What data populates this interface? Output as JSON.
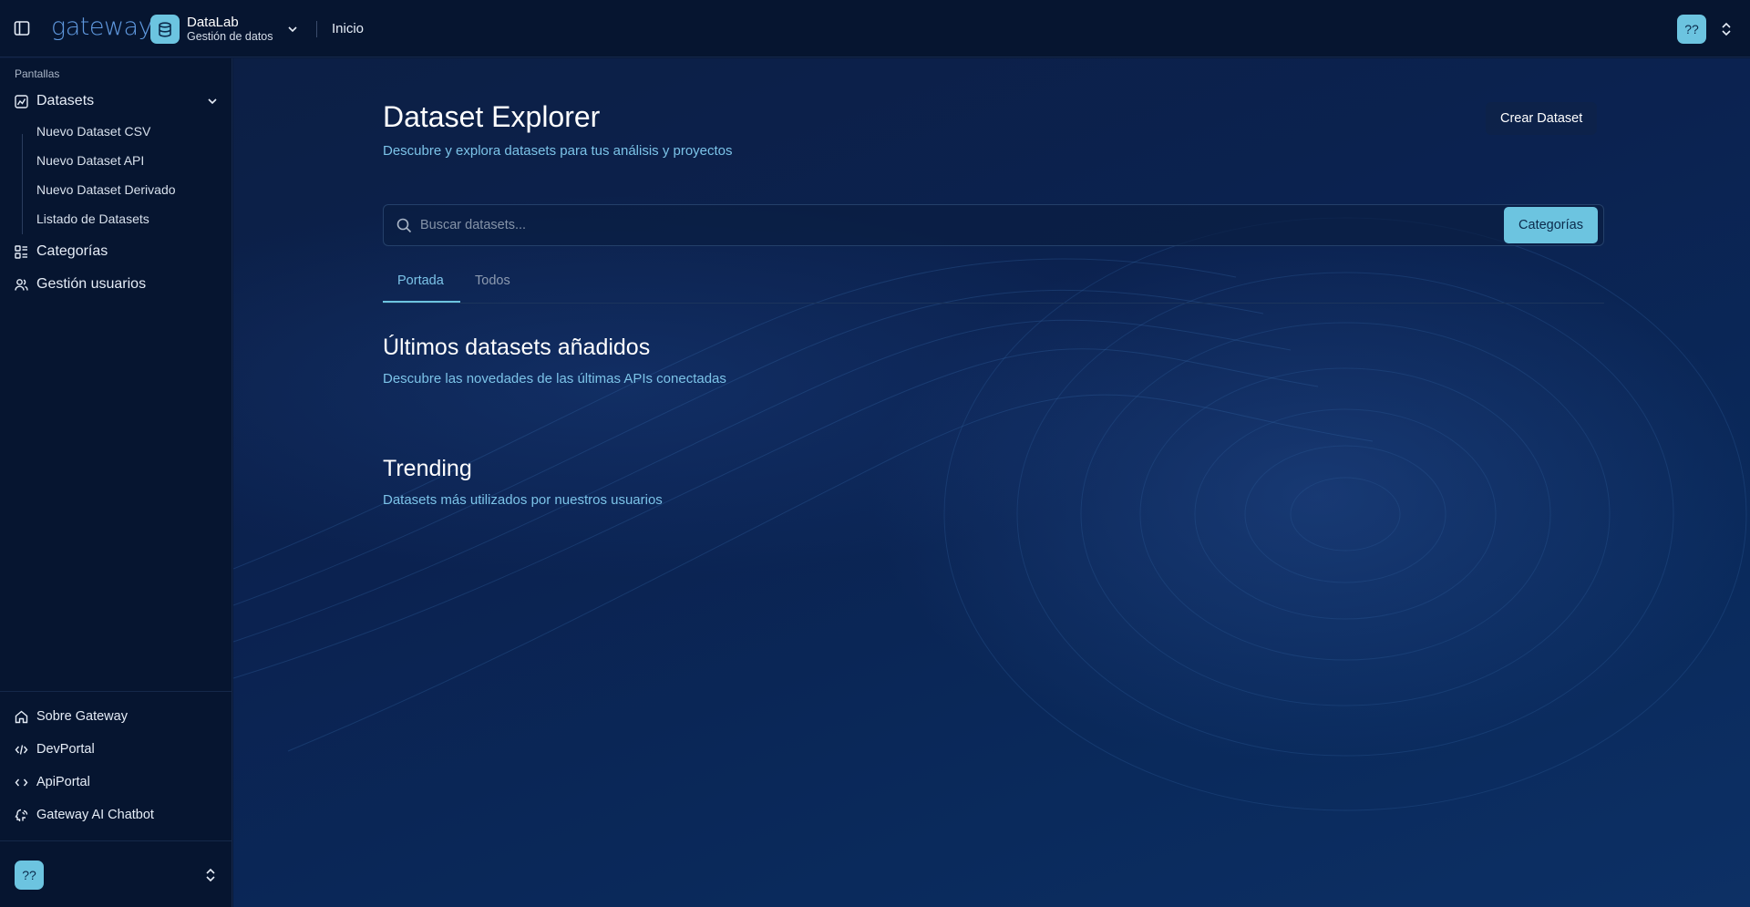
{
  "header": {
    "logo": "gateway",
    "org_name": "DataLab",
    "org_sub": "Gestión de datos",
    "nav_link": "Inicio",
    "avatar": "??"
  },
  "sidebar": {
    "section_label": "Pantallas",
    "items": [
      {
        "label": "Datasets",
        "icon": "dataset-icon"
      },
      {
        "label": "Categorías",
        "icon": "categories-icon"
      },
      {
        "label": "Gestión usuarios",
        "icon": "users-icon"
      }
    ],
    "subitems": [
      {
        "label": "Nuevo Dataset CSV"
      },
      {
        "label": "Nuevo Dataset API"
      },
      {
        "label": "Nuevo Dataset Derivado"
      },
      {
        "label": "Listado de Datasets"
      }
    ],
    "footer": [
      {
        "label": "Sobre Gateway",
        "icon": "home-icon"
      },
      {
        "label": "DevPortal",
        "icon": "code-icon"
      },
      {
        "label": "ApiPortal",
        "icon": "api-icon"
      },
      {
        "label": "Gateway AI Chatbot",
        "icon": "chatbot-icon"
      }
    ],
    "avatar": "??"
  },
  "main": {
    "title": "Dataset Explorer",
    "subtitle": "Descubre y explora datasets para tus análisis y proyectos",
    "create_button": "Crear Dataset",
    "search": {
      "placeholder": "Buscar datasets...",
      "value": ""
    },
    "categories_button": "Categorías",
    "tabs": [
      {
        "label": "Portada",
        "active": true
      },
      {
        "label": "Todos",
        "active": false
      }
    ],
    "sections": [
      {
        "title": "Últimos datasets añadidos",
        "subtitle": "Descubre las novedades de las últimas APIs conectadas"
      },
      {
        "title": "Trending",
        "subtitle": "Datasets más utilizados por nuestros usuarios"
      }
    ]
  },
  "colors": {
    "accent": "#6cc4e0",
    "link_text": "#7cc3e8",
    "header_bg": "#061530",
    "main_bg": "#0b2250",
    "logo": "#5f98de"
  }
}
